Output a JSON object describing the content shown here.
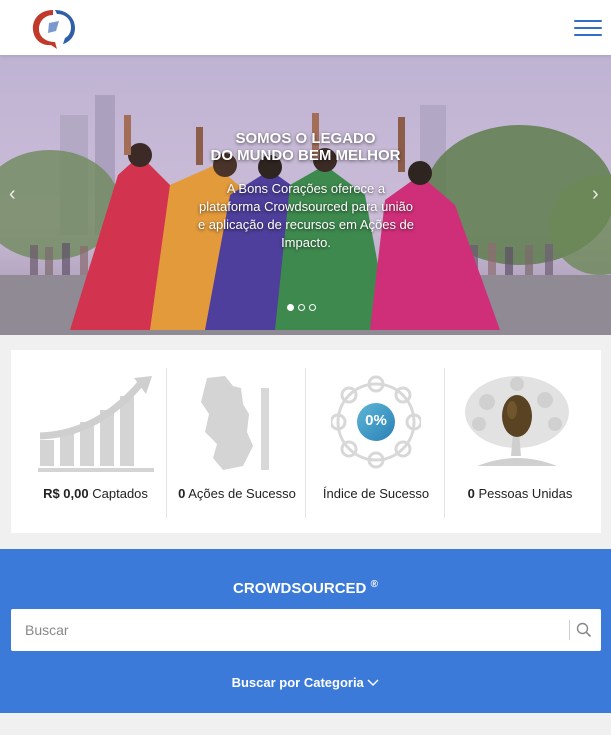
{
  "header": {
    "logo": "bons-coracoes-logo",
    "menu_icon": "hamburger-menu-icon"
  },
  "hero": {
    "title_line1": "SOMOS O LEGADO",
    "title_line2": "DO MUNDO BEM MELHOR",
    "text": "A Bons Corações oferece a plataforma Crowdsourced para união e aplicação de recursos em Ações de Impacto.",
    "prev_icon": "chevron-left-icon",
    "next_icon": "chevron-right-icon",
    "active_slide": 1,
    "slide_count": 3
  },
  "stats": [
    {
      "value": "R$ 0,00",
      "label": "Captados",
      "icon": "growth-chart-icon"
    },
    {
      "value": "0",
      "label": "Ações de Sucesso",
      "icon": "map-icon"
    },
    {
      "value": "",
      "label": "Índice de Sucesso",
      "icon": "success-ring-icon",
      "badge": "0%"
    },
    {
      "value": "0",
      "label": "Pessoas Unidas",
      "icon": "tree-icon"
    }
  ],
  "crowdsourced": {
    "title": "CROWDSOURCED",
    "trademark": "®",
    "search_placeholder": "Buscar",
    "search_value": "",
    "category_label": "Buscar por Categoria"
  },
  "colors": {
    "brand_blue": "#3b7ad9",
    "menu_blue": "#2f6fc9",
    "logo_red": "#c0392b"
  }
}
